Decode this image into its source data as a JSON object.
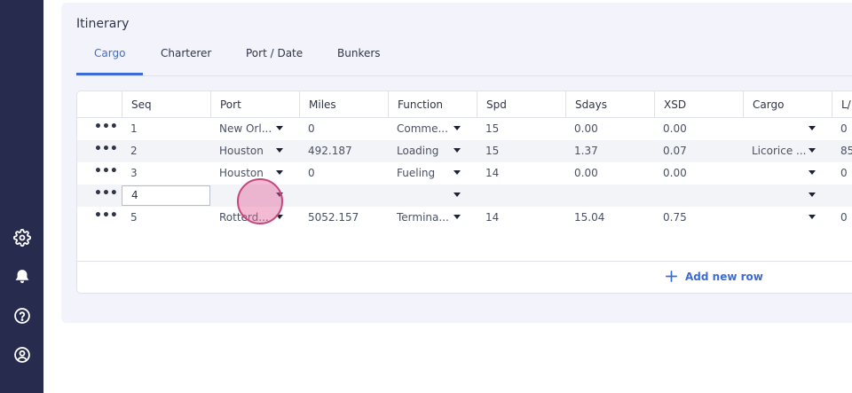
{
  "panel": {
    "title": "Itinerary"
  },
  "tabs": [
    {
      "label": "Cargo",
      "active": true
    },
    {
      "label": "Charterer",
      "active": false
    },
    {
      "label": "Port / Date",
      "active": false
    },
    {
      "label": "Bunkers",
      "active": false
    }
  ],
  "columns": [
    "Seq",
    "Port",
    "Miles",
    "Function",
    "Spd",
    "Sdays",
    "XSD",
    "Cargo",
    "L/"
  ],
  "rows": [
    {
      "seq": "1",
      "port": "New Orl...",
      "miles": "0",
      "function": "Comme...",
      "spd": "15",
      "sdays": "0.00",
      "xsd": "0.00",
      "cargo": "",
      "l": "0"
    },
    {
      "seq": "2",
      "port": "Houston",
      "miles": "492.187",
      "function": "Loading",
      "spd": "15",
      "sdays": "1.37",
      "xsd": "0.07",
      "cargo": "Licorice ...",
      "l": "85"
    },
    {
      "seq": "3",
      "port": "Houston",
      "miles": "0",
      "function": "Fueling",
      "spd": "14",
      "sdays": "0.00",
      "xsd": "0.00",
      "cargo": "",
      "l": "0"
    },
    {
      "seq": "4",
      "port": "",
      "miles": "",
      "function": "",
      "spd": "",
      "sdays": "",
      "xsd": "",
      "cargo": "",
      "l": ""
    },
    {
      "seq": "5",
      "port": "Rotterd...",
      "miles": "5052.157",
      "function": "Termina...",
      "spd": "14",
      "sdays": "15.04",
      "xsd": "0.75",
      "cargo": "",
      "l": "0"
    }
  ],
  "row_actions_glyph": "•••",
  "add_row": {
    "label": "Add new row"
  },
  "sidebar": {
    "icons": [
      "gear-icon",
      "bell-icon",
      "help-icon",
      "user-icon"
    ]
  },
  "colors": {
    "accent": "#3d6bd6",
    "sidebar": "#272c4e",
    "panel": "#f3f4fb"
  }
}
